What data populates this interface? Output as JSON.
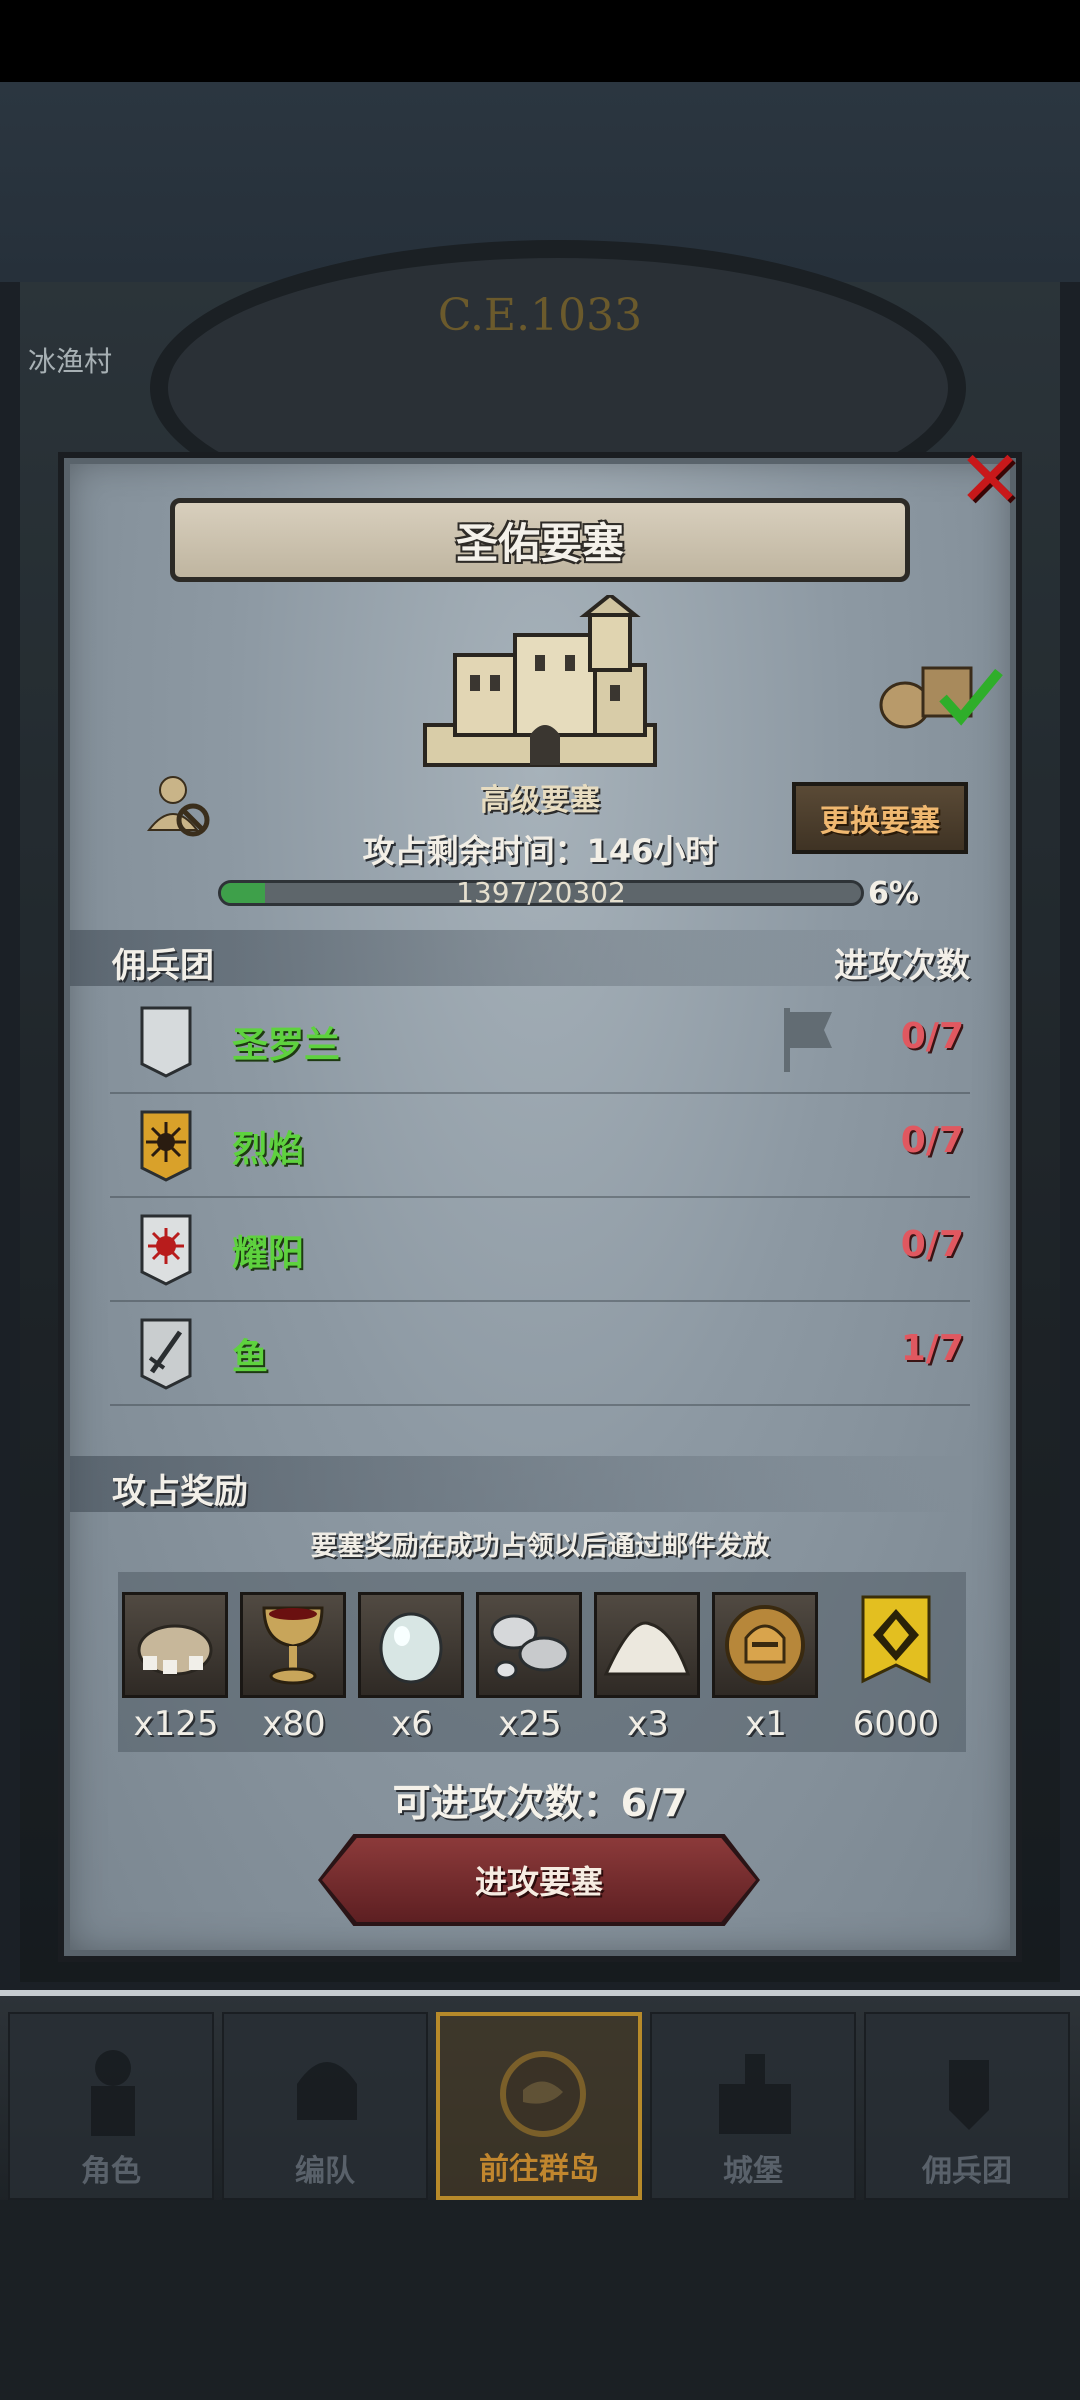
{
  "era": "C.E.1033",
  "map": {
    "village_name": "冰渔村"
  },
  "dialog": {
    "title": "圣佑要塞",
    "fortress_level": "高级要塞",
    "change_fortress_label": "更换要塞",
    "remaining_time": "攻占剩余时间：146小时",
    "progress_text": "1397/20302",
    "progress_fraction": 0.069,
    "progress_percent_text": "6%"
  },
  "mercenaries": {
    "header_left": "佣兵团",
    "header_right": "进攻次数",
    "rows": [
      {
        "name": "圣罗兰",
        "attacks": "0/7",
        "banner_icon": "moon-banner-icon",
        "has_flag": true
      },
      {
        "name": "烈焰",
        "attacks": "0/7",
        "banner_icon": "sun-banner-icon",
        "has_flag": false
      },
      {
        "name": "耀阳",
        "attacks": "0/7",
        "banner_icon": "red-sun-banner-icon",
        "has_flag": false
      },
      {
        "name": "鱼",
        "attacks": "1/7",
        "banner_icon": "sword-banner-icon",
        "has_flag": false
      }
    ]
  },
  "rewards": {
    "header": "攻占奖励",
    "note": "要塞奖励在成功占领以后通过邮件发放",
    "items": [
      {
        "icon": "ore-sack-icon",
        "qty": "x125"
      },
      {
        "icon": "goblet-icon",
        "qty": "x80"
      },
      {
        "icon": "gem-stone-icon",
        "qty": "x6"
      },
      {
        "icon": "silver-ore-icon",
        "qty": "x25"
      },
      {
        "icon": "salt-pile-icon",
        "qty": "x3"
      },
      {
        "icon": "knight-helmet-coin-icon",
        "qty": "x1"
      },
      {
        "icon": "guild-banner-icon",
        "qty": "6000"
      }
    ]
  },
  "attack": {
    "remaining_label": "可进攻次数：6/7",
    "button_label": "进攻要塞"
  },
  "nav": {
    "tabs": [
      {
        "label": "角色",
        "icon": "knight-icon",
        "active": false
      },
      {
        "label": "编队",
        "icon": "helmet-icon",
        "active": false
      },
      {
        "label": "前往群岛",
        "icon": "globe-icon",
        "active": true
      },
      {
        "label": "城堡",
        "icon": "castle-icon",
        "active": false
      },
      {
        "label": "佣兵团",
        "icon": "mercenary-icon",
        "active": false
      }
    ]
  },
  "colors": {
    "merc_name": "#5ed23e",
    "attack_count": "#e05860",
    "progress_fill": "#3ea04a",
    "close_x": "#c8181a",
    "active_tab": "#c0862e"
  }
}
